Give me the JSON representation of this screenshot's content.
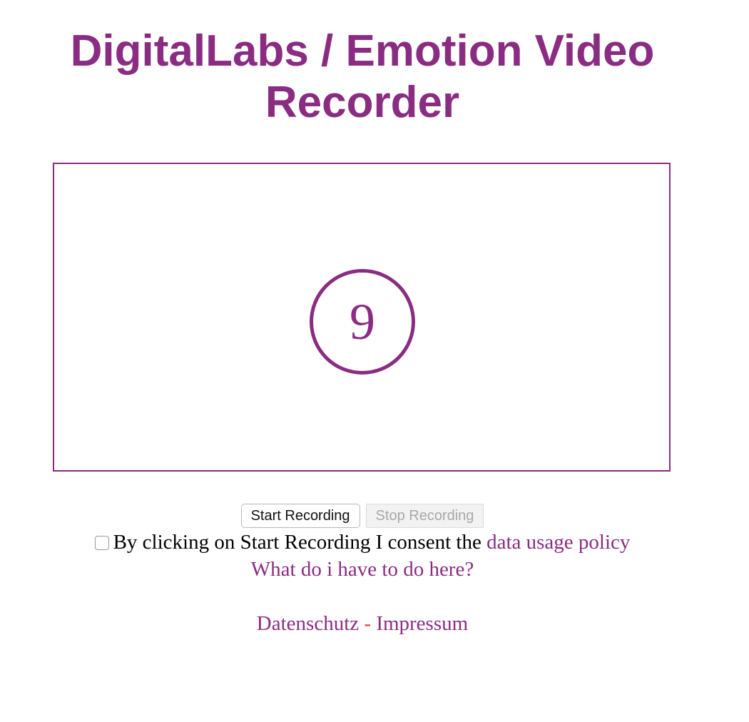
{
  "header": {
    "title_line1": "DigitalLabs / Emotion Video",
    "title_line2": "Recorder"
  },
  "video": {
    "countdown_value": "9"
  },
  "controls": {
    "start_label": "Start Recording",
    "stop_label": "Stop Recording",
    "stop_disabled": true
  },
  "consent": {
    "checked": false,
    "text": "By clicking on Start Recording I consent the ",
    "policy_link": "data usage policy"
  },
  "help": {
    "link": "What do i have to do here?"
  },
  "footer": {
    "privacy_link": "Datenschutz",
    "separator": " - ",
    "imprint_link": "Impressum"
  },
  "colors": {
    "brand": "#8a2c82",
    "separator": "#e03a3a"
  }
}
